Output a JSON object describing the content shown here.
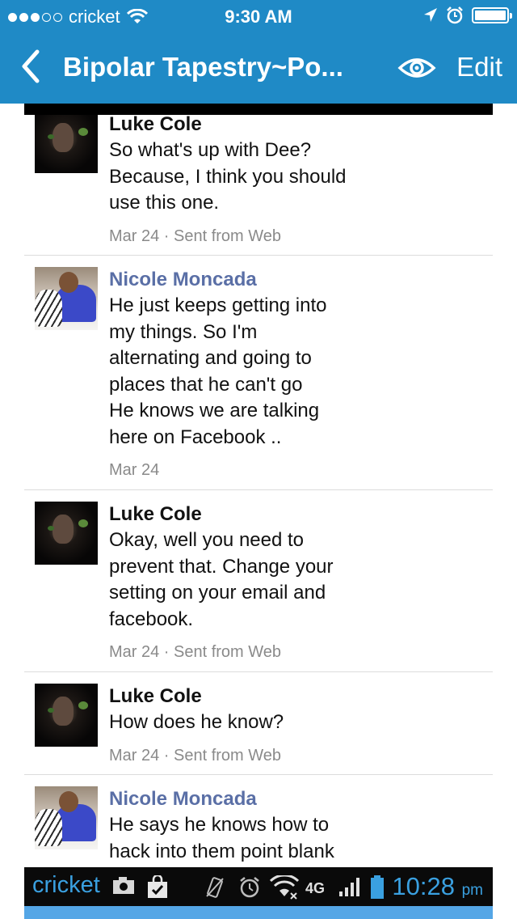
{
  "status_bar": {
    "carrier": "cricket",
    "time": "9:30 AM",
    "battery_level": 1.0
  },
  "nav": {
    "title": "Bipolar Tapestry~Po...",
    "edit_label": "Edit",
    "icons": [
      "chevron-left-icon",
      "eye-icon"
    ]
  },
  "messages": [
    {
      "author": "Luke Cole",
      "author_style": "black",
      "lines": [
        "So what's up with Dee?",
        "Because, I think you should",
        "use this one."
      ],
      "meta": "Mar 24 · Sent from Web"
    },
    {
      "author": "Nicole Moncada",
      "author_style": "blue",
      "lines": [
        "He just keeps getting into",
        "my things. So I'm",
        "alternating and going to",
        "places that he can't go",
        "He knows we are talking",
        "here on Facebook .."
      ],
      "meta": "Mar 24"
    },
    {
      "author": "Luke Cole",
      "author_style": "black",
      "lines": [
        "Okay, well you need to",
        "prevent that. Change your",
        "setting on your email and",
        "facebook."
      ],
      "meta": "Mar 24 · Sent from Web"
    },
    {
      "author": "Luke Cole",
      "author_style": "black",
      "lines": [
        "How does he know?"
      ],
      "meta": "Mar 24 · Sent from Web"
    },
    {
      "author": "Nicole Moncada",
      "author_style": "blue",
      "lines": [
        "He says he knows how to",
        "hack into them point blank"
      ],
      "meta": ""
    }
  ],
  "android_status": {
    "carrier": "cricket",
    "network": "4G",
    "time": "10:28",
    "ampm": "pm"
  },
  "colors": {
    "ios_bar": "#1f8ac6",
    "author_blue": "#5a6fa6",
    "android_accent": "#3aa0e0"
  }
}
